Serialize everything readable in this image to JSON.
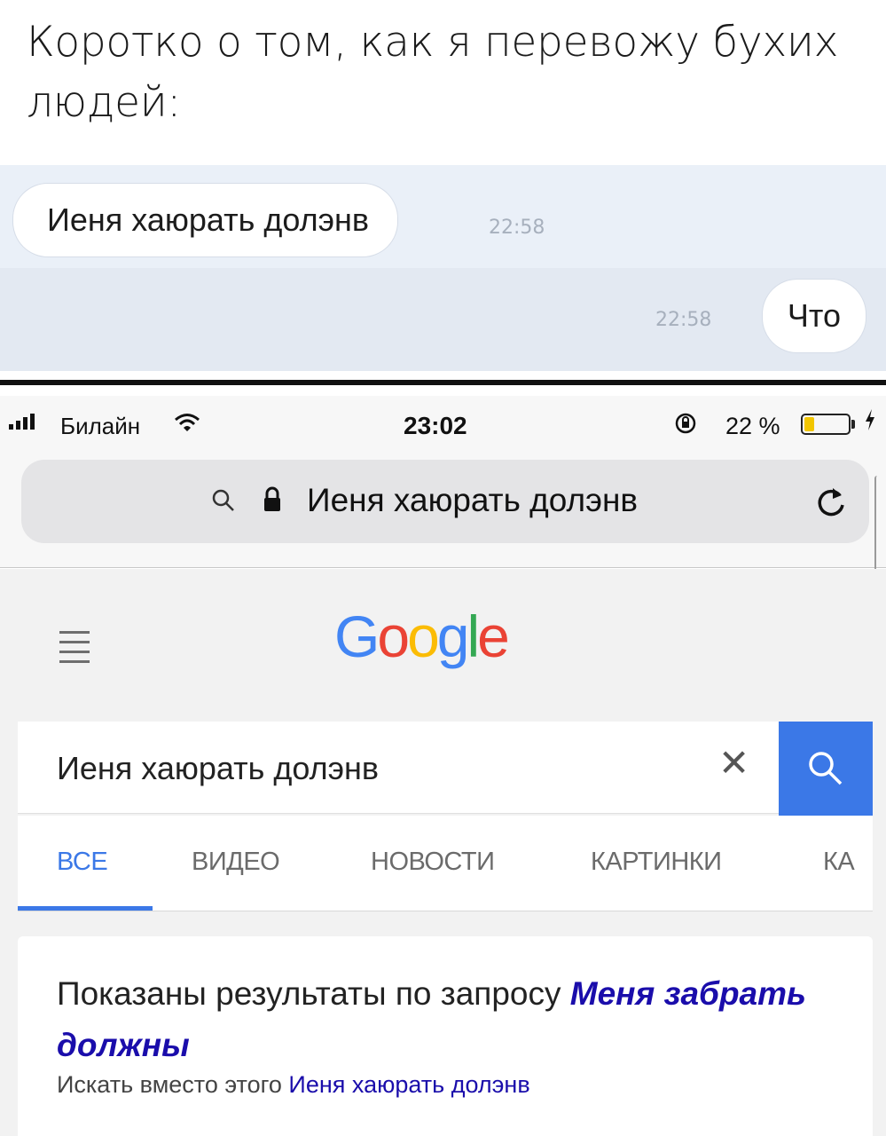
{
  "caption": "Коротко о том, как я перевожу бухих людей:",
  "chat": {
    "incoming_message": "Иеня хаюрать долэнв",
    "incoming_time": "22:58",
    "outgoing_message": "Что",
    "outgoing_time": "22:58"
  },
  "status_bar": {
    "carrier": "Билайн",
    "time": "23:02",
    "battery_percent": "22 %",
    "battery_level": 0.22
  },
  "browser": {
    "url_text": "Иеня хаюрать долэнв"
  },
  "google": {
    "logo_letters": [
      {
        "ch": "G",
        "color": "#4285F4"
      },
      {
        "ch": "o",
        "color": "#EA4335"
      },
      {
        "ch": "o",
        "color": "#FBBC05"
      },
      {
        "ch": "g",
        "color": "#4285F4"
      },
      {
        "ch": "l",
        "color": "#34A853"
      },
      {
        "ch": "e",
        "color": "#EA4335"
      }
    ],
    "search_query": "Иеня хаюрать долэнв",
    "tabs": [
      "ВСЕ",
      "ВИДЕО",
      "НОВОСТИ",
      "КАРТИНКИ",
      "КА"
    ],
    "active_tab": "ВСЕ",
    "shown_results_prefix": "Показаны результаты по запросу",
    "corrected_query": "Меня забрать должны",
    "search_instead_prefix": "Искать вместо этого",
    "original_query": "Иеня хаюрать долэнв"
  },
  "colors": {
    "google_blue": "#3b78e7",
    "link_purple": "#1a0dab",
    "chat_background": "#e6ecf5"
  }
}
